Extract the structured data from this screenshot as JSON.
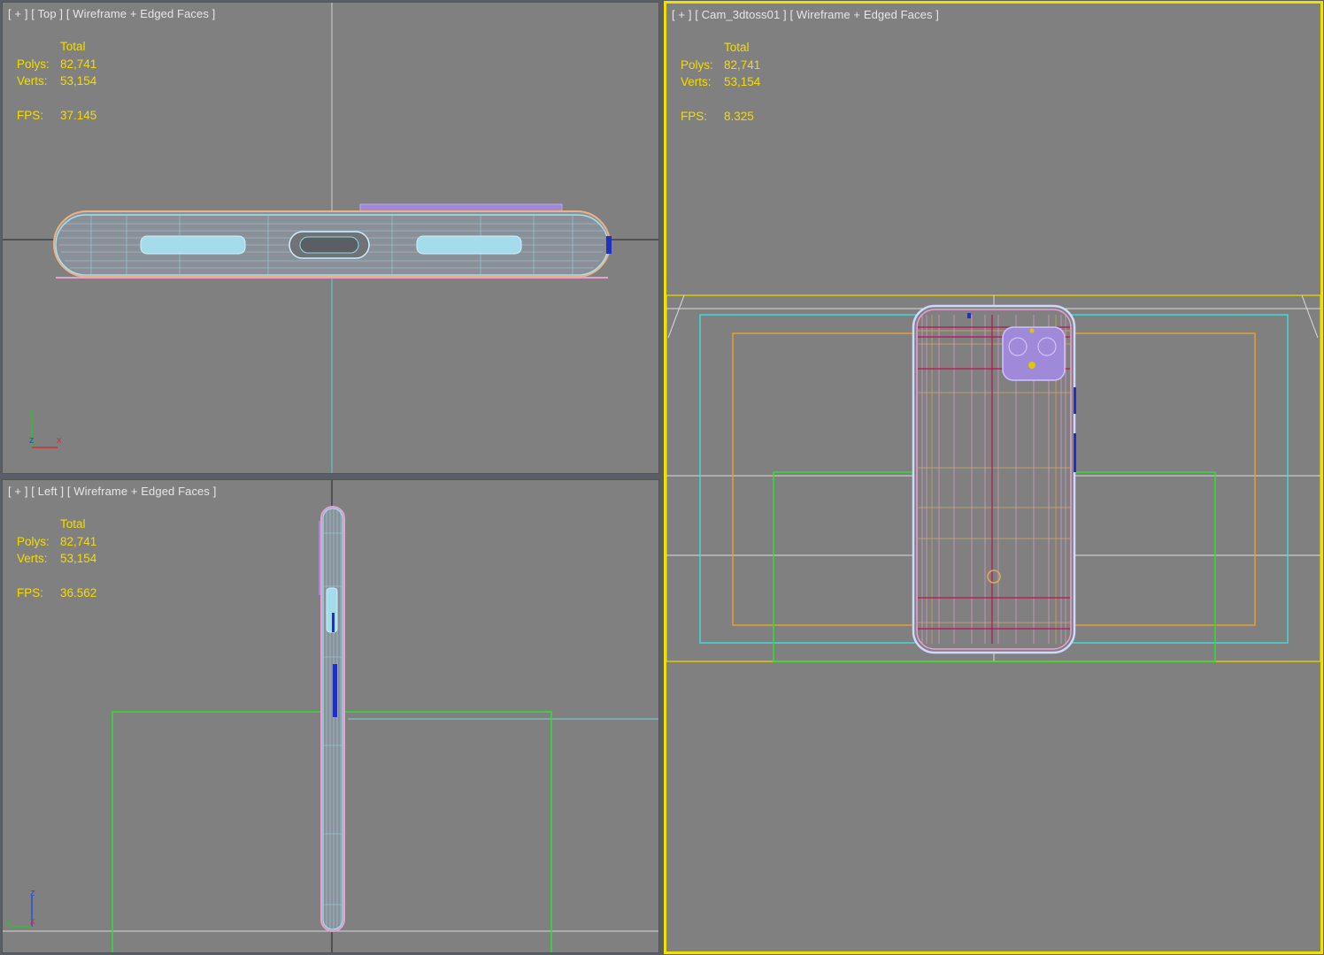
{
  "viewports": {
    "top": {
      "label": "[ + ] [ Top ] [ Wireframe + Edged Faces ]",
      "stats": {
        "header": "Total",
        "polys_label": "Polys:",
        "polys": "82,741",
        "verts_label": "Verts:",
        "verts": "53,154",
        "fps_label": "FPS:",
        "fps": "37.145"
      },
      "axes": {
        "a": "y",
        "b": "z",
        "c": "x"
      }
    },
    "left": {
      "label": "[ + ] [ Left ] [ Wireframe + Edged Faces ]",
      "stats": {
        "header": "Total",
        "polys_label": "Polys:",
        "polys": "82,741",
        "verts_label": "Verts:",
        "verts": "53,154",
        "fps_label": "FPS:",
        "fps": "36.562"
      },
      "axes": {
        "a": "z",
        "b": "y",
        "c": "x"
      }
    },
    "camera": {
      "label": "[ + ] [ Cam_3dtoss01 ] [ Wireframe + Edged Faces ]",
      "stats": {
        "header": "Total",
        "polys_label": "Polys:",
        "polys": "82,741",
        "verts_label": "Verts:",
        "verts": "53,154",
        "fps_label": "FPS:",
        "fps": "8.325"
      },
      "active": true
    }
  },
  "colors": {
    "viewport_bg": "#808080",
    "active_border": "#f0e000",
    "stats_text": "#f5dc00",
    "label_text": "#e6e6e6",
    "wire_cyan": "#9fe3f0",
    "wire_pink": "#e9a0d0",
    "wire_orange": "#e0a860",
    "safe_frame_cyan": "#40d8d8",
    "safe_frame_orange": "#e0a030",
    "safe_frame_green": "#30e030"
  }
}
